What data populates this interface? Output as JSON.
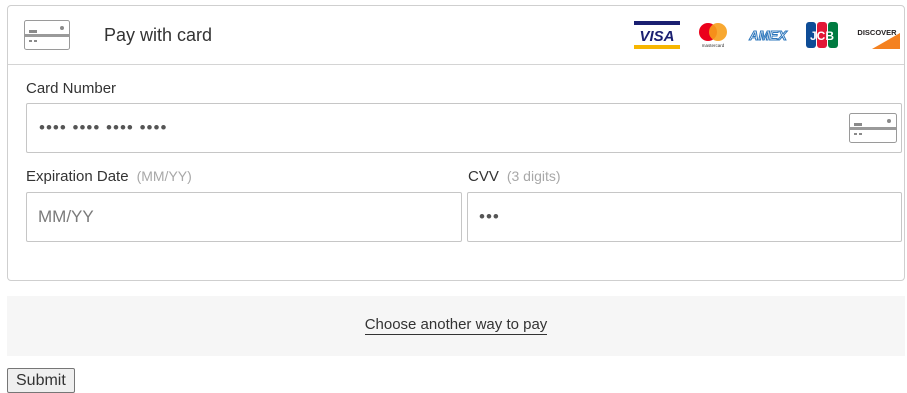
{
  "header": {
    "title": "Pay with card",
    "icon": "credit-card-icon"
  },
  "brands": [
    {
      "name": "VISA",
      "icon": "visa-icon"
    },
    {
      "name": "mastercard",
      "icon": "mastercard-icon"
    },
    {
      "name": "AMEX",
      "icon": "amex-icon"
    },
    {
      "name": "JCB",
      "icon": "jcb-icon"
    },
    {
      "name": "DISCOVER",
      "icon": "discover-icon"
    }
  ],
  "card_number": {
    "label": "Card Number",
    "value": "•••• •••• •••• ••••"
  },
  "expiration": {
    "label": "Expiration Date",
    "hint": "(MM/YY)",
    "placeholder": "MM/YY"
  },
  "cvv": {
    "label": "CVV",
    "hint": "(3 digits)",
    "value": "•••"
  },
  "alt_pay": {
    "label": "Choose another way to pay"
  },
  "submit": {
    "label": "Submit"
  },
  "colors": {
    "visa_blue": "#1a1f71",
    "visa_gold": "#f7b600",
    "mc_red": "#eb001b",
    "mc_orange": "#f79e1b",
    "amex_blue": "#2e77bc",
    "discover_orange": "#f48120"
  }
}
